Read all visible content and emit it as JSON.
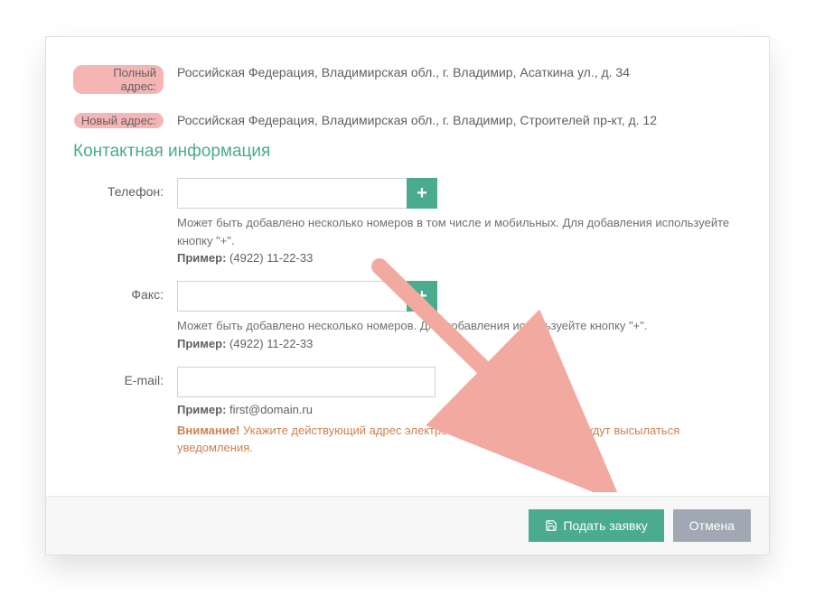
{
  "addresses": {
    "full_label": "Полный адрес:",
    "full_value": "Российская Федерация, Владимирская обл., г. Владимир, Асаткина ул., д. 34",
    "new_label": "Новый адрес:",
    "new_value": "Российская Федерация, Владимирская обл., г. Владимир, Строителей пр-кт, д. 12"
  },
  "section": {
    "contact_title": "Контактная информация"
  },
  "phone": {
    "label": "Телефон:",
    "help": "Может быть добавлено несколько номеров в том числе и мобильных. Для добавления используейте кнопку \"+\".",
    "example_label": "Пример:",
    "example_value": "(4922) 11-22-33"
  },
  "fax": {
    "label": "Факс:",
    "help": "Может быть добавлено несколько номеров. Для добавления используейте кнопку \"+\".",
    "example_label": "Пример:",
    "example_value": "(4922) 11-22-33"
  },
  "email": {
    "label": "E-mail:",
    "example_label": "Пример:",
    "example_value": "first@domain.ru",
    "warn_label": "Внимание!",
    "warn_text": "Укажите действующий адрес электронной почты, на который будут высылаться уведомления."
  },
  "buttons": {
    "submit": "Подать заявку",
    "cancel": "Отмена"
  },
  "icons": {
    "plus": "+"
  }
}
